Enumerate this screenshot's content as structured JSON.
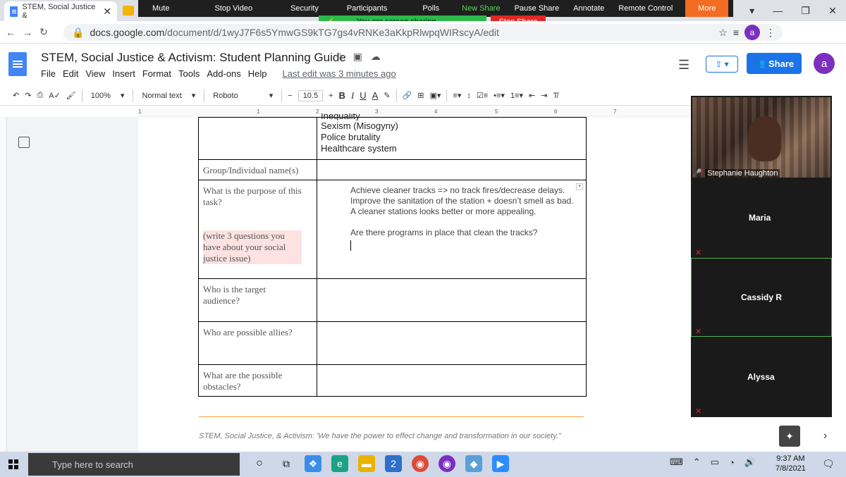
{
  "browser": {
    "tab_title": "STEM, Social Justice &",
    "tab_close": "✕",
    "url_domain": "docs.google.com",
    "url_path": "/document/d/1wyJ7F6s5YmwGS9kTG7gs4vRNKe3aKkpRlwpqWIRscyA/edit"
  },
  "zoom": {
    "toolbar": [
      "Mute",
      "Stop Video",
      "Security",
      "Participants",
      "Polls",
      "New Share",
      "Pause Share",
      "Annotate",
      "Remote Control",
      "More"
    ],
    "sharing_status": "You are screen sharing",
    "stop_share": "Stop Share",
    "participants": [
      {
        "name": "Stephanie Haughton"
      },
      {
        "name": "Maria"
      },
      {
        "name": "Cassidy R"
      },
      {
        "name": "Alyssa"
      }
    ]
  },
  "docs": {
    "title": "STEM, Social Justice & Activism: Student Planning Guide",
    "menu": [
      "File",
      "Edit",
      "View",
      "Insert",
      "Format",
      "Tools",
      "Add-ons",
      "Help"
    ],
    "last_edit": "Last edit was 3 minutes ago",
    "share_label": "Share",
    "account_initial": "a",
    "zoom_level": "100%",
    "style": "Normal text",
    "font": "Roboto",
    "font_size": "10.5",
    "ruler_numbers": [
      "1",
      "1",
      "2",
      "3",
      "4",
      "5",
      "6",
      "7"
    ]
  },
  "table": {
    "top_right_lines": [
      "Inequality",
      "Sexism (Misogyny)",
      "Police brutality",
      "Healthcare system"
    ],
    "rows": [
      {
        "label": "Group/Individual name(s)",
        "answer": []
      },
      {
        "label": "What is the purpose of this task?",
        "note": "(write 3 questions you have about your social justice issue)",
        "answer": [
          "Achieve cleaner tracks => no track fires/decrease delays.",
          "Improve the sanitation of the station + doesn’t smell as bad.",
          "A cleaner stations looks better or more appealing.",
          "",
          "Are there programs in place that clean the tracks?"
        ]
      },
      {
        "label": "Who is the target audience?",
        "answer": []
      },
      {
        "label": "Who are possible allies?",
        "answer": []
      },
      {
        "label": "What are the possible obstacles?",
        "answer": []
      }
    ]
  },
  "footer": "STEM, Social Justice, & Activism: 'We have the power to effect change and transformation in our society.\"",
  "taskbar": {
    "search_placeholder": "Type here to search",
    "time": "9:37 AM",
    "date": "7/8/2021",
    "badge": "2"
  }
}
